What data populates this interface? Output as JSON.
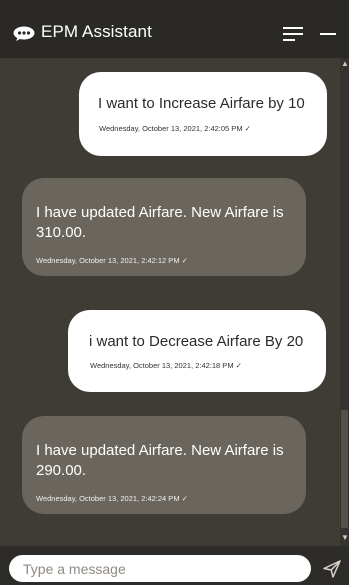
{
  "header": {
    "title": "EPM Assistant",
    "icons": {
      "chat": "chat-bubble-icon",
      "menu": "menu-icon",
      "minimize": "minimize-icon"
    }
  },
  "messages": [
    {
      "sender": "user",
      "text": "I want to Increase Airfare by 10",
      "time": "Wednesday, October 13, 2021, 2:42:05 PM ✓"
    },
    {
      "sender": "bot",
      "text": "I have updated Airfare. New  Airfare is 310.00.",
      "time": "Wednesday, October 13, 2021, 2:42:12 PM ✓"
    },
    {
      "sender": "user",
      "text": "i want to Decrease Airfare By 20",
      "time": "Wednesday, October 13, 2021, 2:42:18 PM ✓"
    },
    {
      "sender": "bot",
      "text": "I have updated Airfare. New  Airfare is 290.00.",
      "time": "Wednesday, October 13, 2021, 2:42:24 PM ✓"
    }
  ],
  "composer": {
    "placeholder": "Type a message",
    "send_icon": "send-icon"
  },
  "colors": {
    "header_bg": "#2a2925",
    "chat_bg": "#3f3c36",
    "user_bubble": "#ffffff",
    "bot_bubble": "#6a655d"
  }
}
